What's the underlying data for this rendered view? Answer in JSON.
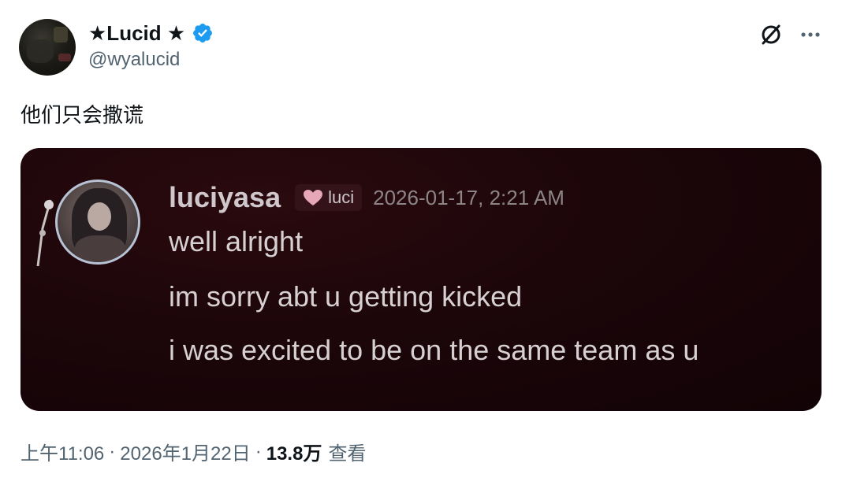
{
  "author": {
    "display_name": "★Lucid ★",
    "handle": "@wyalucid",
    "verified": true,
    "verified_color": "#1d9bf0"
  },
  "actions": {
    "grok_icon": "grok-icon",
    "more_icon": "more-horizontal-icon"
  },
  "tweet": {
    "text": "他们只会撒谎"
  },
  "media": {
    "message": {
      "username": "luciyasa",
      "tag_label": "luci",
      "tag_icon": "heart-icon",
      "timestamp": "2026-01-17, 2:21 AM",
      "lines": [
        "well alright",
        "im sorry abt u getting kicked",
        "i was excited to be on the same team as u"
      ]
    }
  },
  "meta": {
    "time": "上午11:06",
    "date": "2026年1月22日",
    "views_count": "13.8万",
    "views_label": "查看",
    "separator": "·"
  }
}
